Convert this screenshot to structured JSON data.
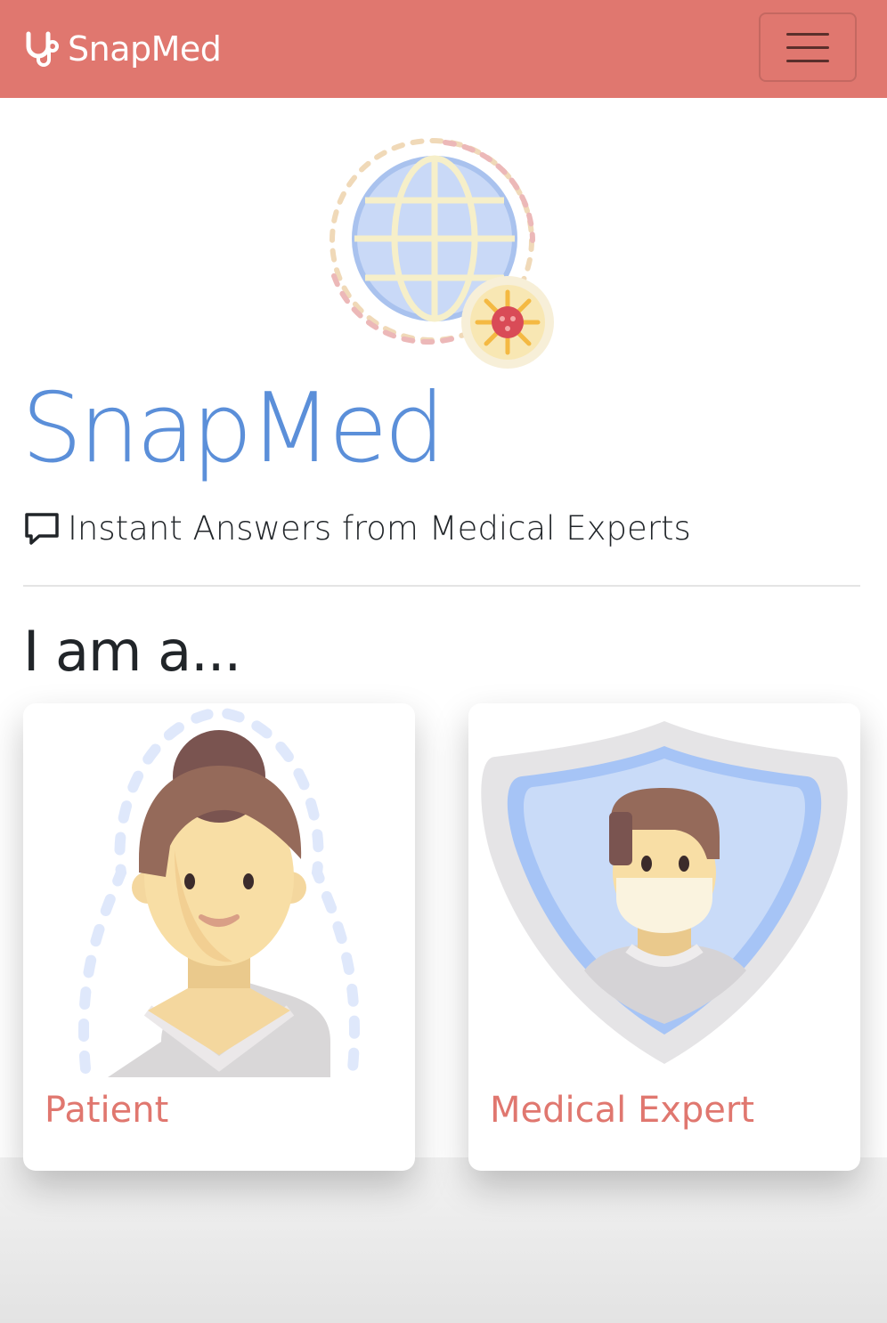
{
  "navbar": {
    "brand": "SnapMed",
    "brand_icon": "stethoscope-icon",
    "menu_icon": "hamburger-menu-icon",
    "bg_color": "#e0776f"
  },
  "hero": {
    "icon": "globe-virus-icon",
    "title": "SnapMed",
    "title_color": "#5b8fd9",
    "tagline_icon": "chat-bubble-icon",
    "tagline": "Instant Answers from Medical Experts"
  },
  "chooser": {
    "heading": "I am a...",
    "cards": [
      {
        "label": "Patient",
        "icon": "female-patient-icon"
      },
      {
        "label": "Medical Expert",
        "icon": "doctor-shield-icon"
      }
    ],
    "label_color": "#e0776f"
  }
}
